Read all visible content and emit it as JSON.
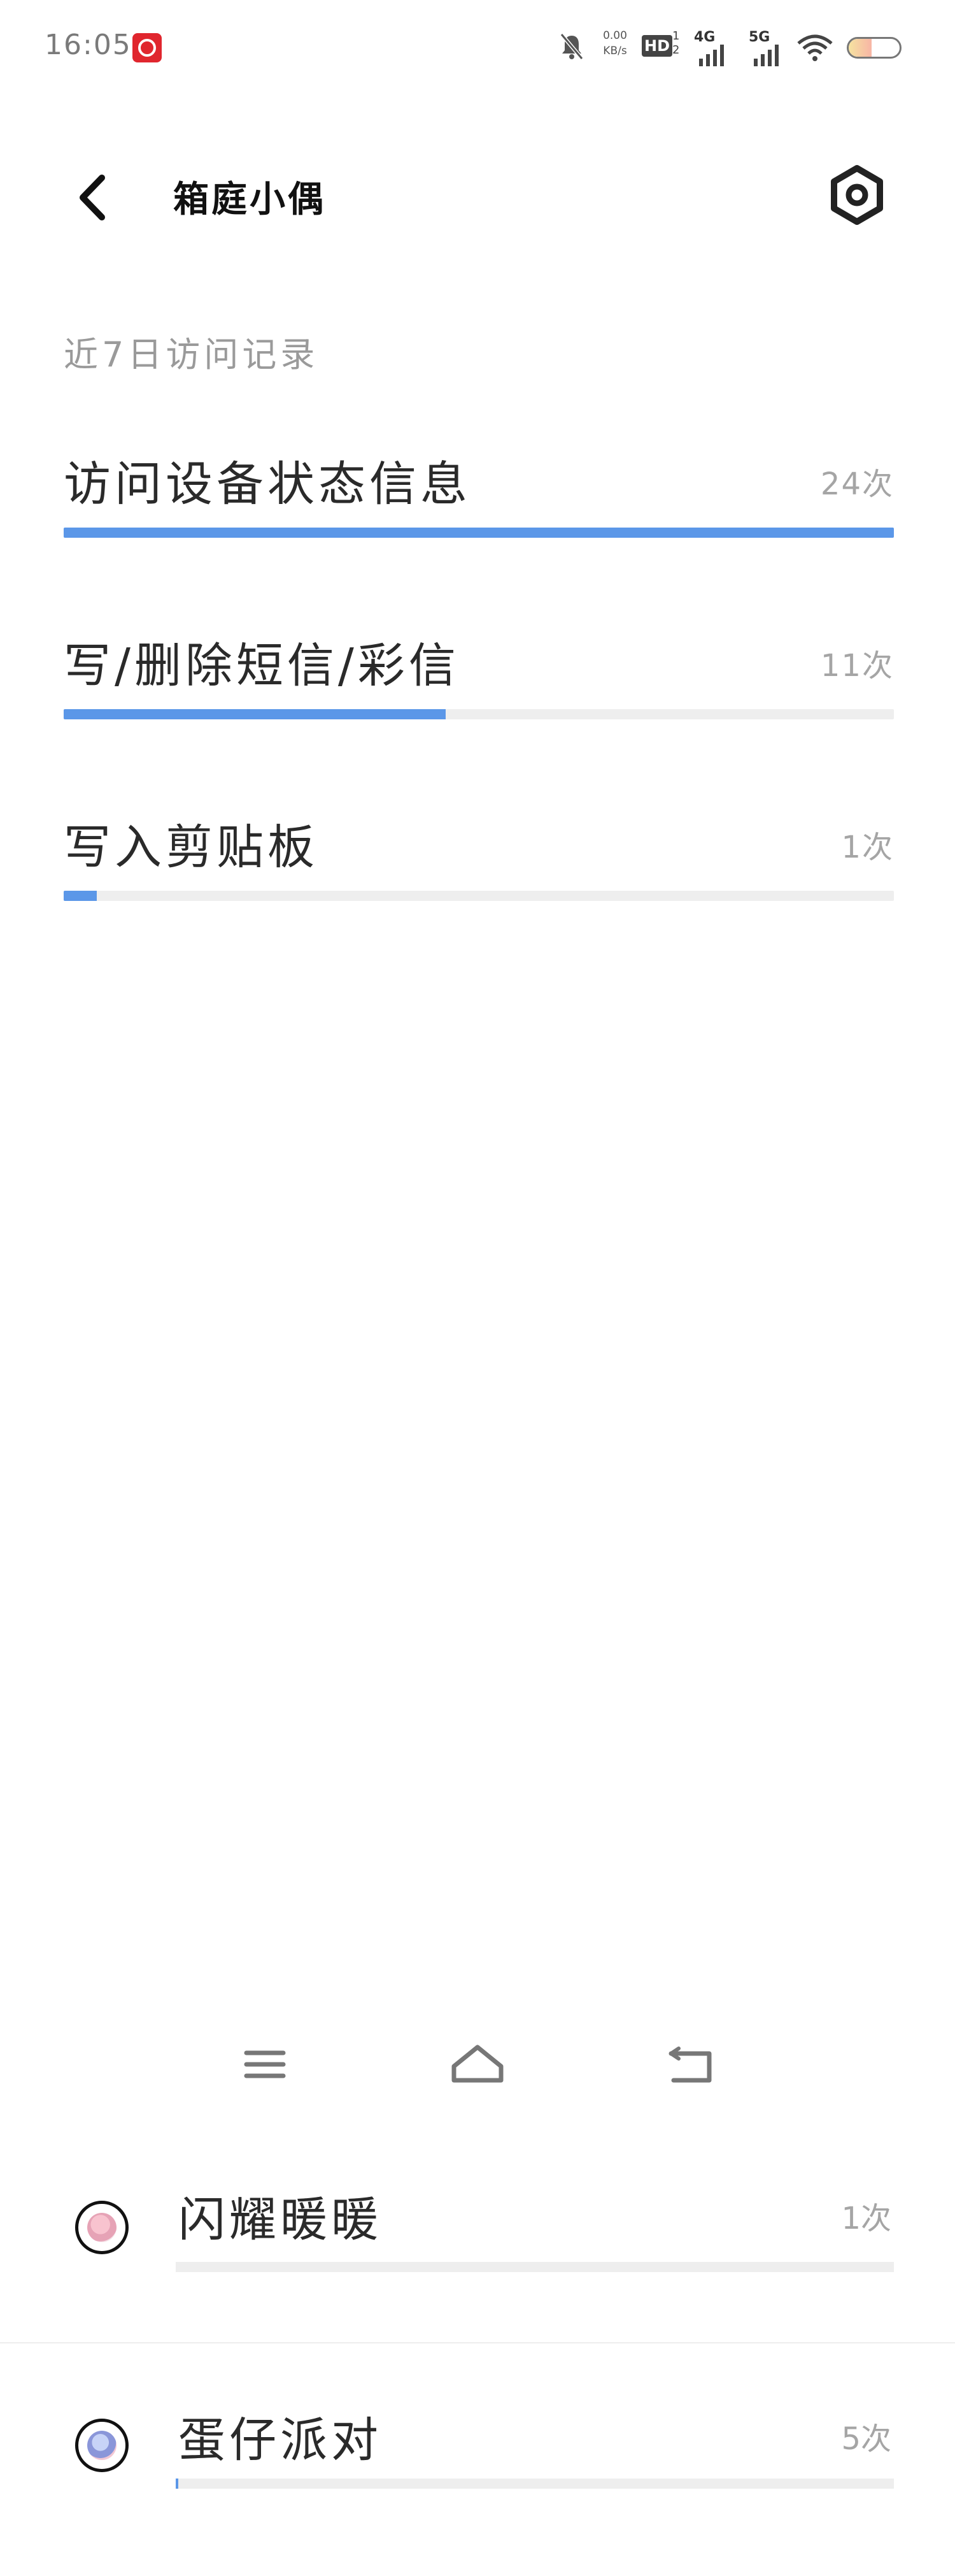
{
  "status_bar": {
    "time": "16:05",
    "speed_value": "0.00",
    "speed_unit": "KB/s",
    "hd_label": "HD",
    "hd_sub": "1\n2",
    "net_1": "4G",
    "net_2": "5G",
    "battery_level": 0.45
  },
  "header": {
    "title": "箱庭小偶",
    "back_icon": "chevron-left-icon",
    "settings_icon": "gear-icon"
  },
  "section": {
    "title": "近7日访问记录"
  },
  "records": [
    {
      "label": "访问设备状态信息",
      "count": "24次",
      "fill": 1.0
    },
    {
      "label": "写/删除短信/彩信",
      "count": "11次",
      "fill": 0.46
    },
    {
      "label": "写入剪贴板",
      "count": "1次",
      "fill": 0.04
    }
  ],
  "nav": {
    "menu_icon": "menu-icon",
    "home_icon": "home-icon",
    "back_icon": "back-icon"
  },
  "apps": [
    {
      "name": "闪耀暖暖",
      "count": "1次",
      "fill": 0.0
    },
    {
      "name": "蛋仔派对",
      "count": "5次",
      "fill": 0.003
    }
  ],
  "colors": {
    "accent": "#5b97e8",
    "track": "#eeeeee",
    "muted_text": "#a5a5a5"
  }
}
